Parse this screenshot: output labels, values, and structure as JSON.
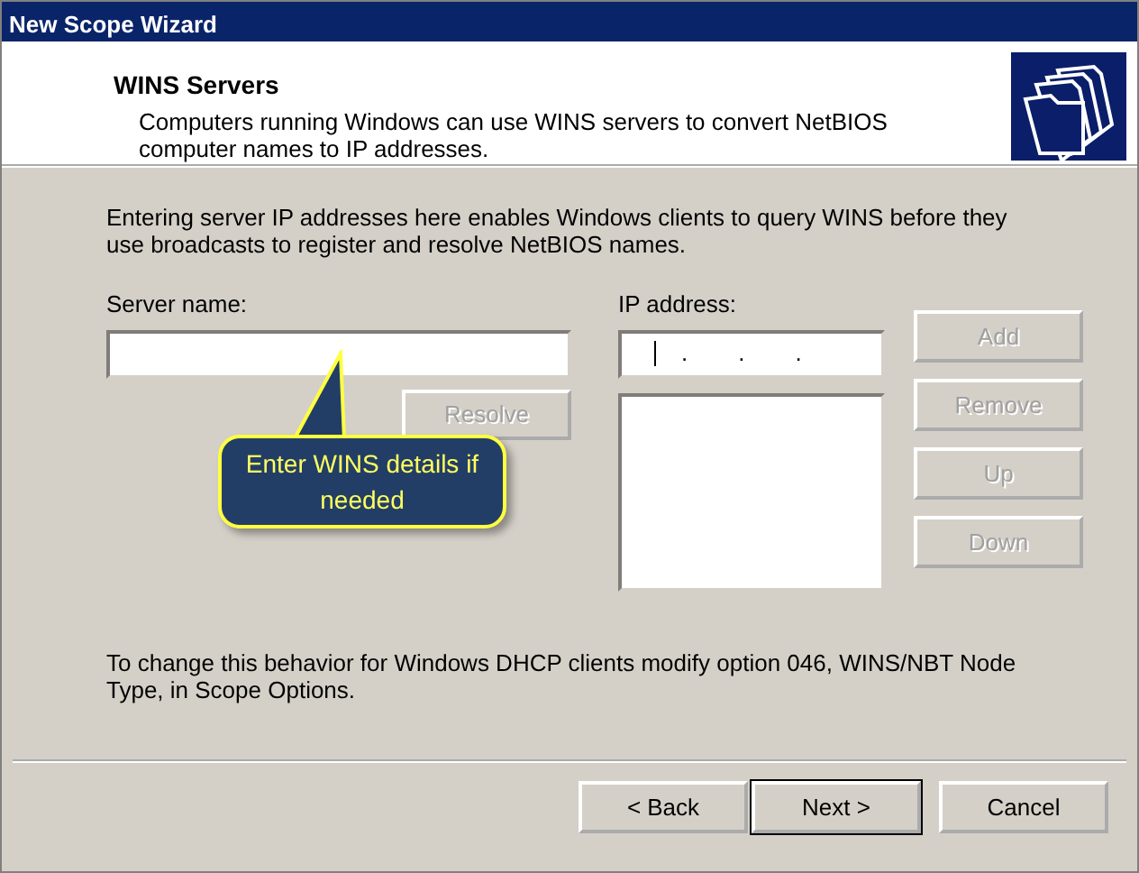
{
  "window": {
    "title": "New Scope Wizard"
  },
  "header": {
    "title": "WINS Servers",
    "subtitle": "Computers running Windows can use WINS servers to convert NetBIOS computer names to IP addresses."
  },
  "intro": "Entering server IP addresses here enables Windows clients to query WINS before they use broadcasts to register and resolve NetBIOS names.",
  "server_name": {
    "label": "Server name:"
  },
  "resolve_button": {
    "label": "Resolve",
    "disabled": true
  },
  "ip_address": {
    "label": "IP address:",
    "dots": [
      ".",
      ".",
      "."
    ]
  },
  "side_buttons": [
    {
      "label": "Add",
      "disabled": true
    },
    {
      "label": "Remove",
      "disabled": true
    },
    {
      "label": "Up",
      "disabled": true
    },
    {
      "label": "Down",
      "disabled": true
    }
  ],
  "note": "To change this behavior for Windows DHCP clients modify option 046, WINS/NBT Node Type, in Scope Options.",
  "callout": {
    "text": "Enter WINS details if needed"
  },
  "footer_buttons": [
    {
      "label": "< Back",
      "default": false
    },
    {
      "label": "Next >",
      "default": true
    },
    {
      "label": "Cancel",
      "default": false
    }
  ]
}
